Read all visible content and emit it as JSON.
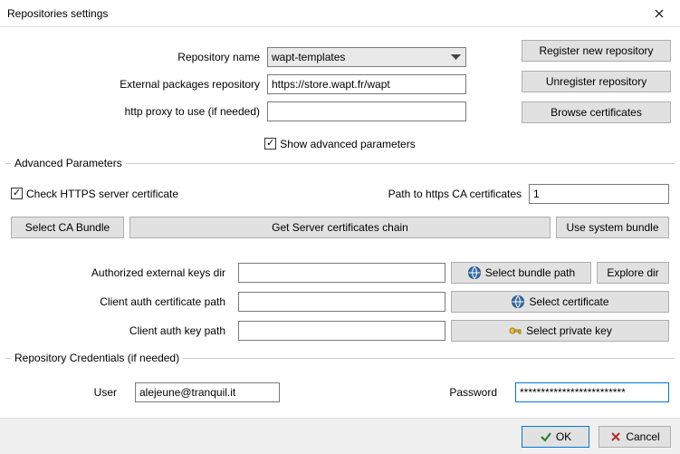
{
  "window": {
    "title": "Repositories settings"
  },
  "labels": {
    "repo_name": "Repository name",
    "ext_repo": "External packages repository",
    "http_proxy": "http proxy to use (if needed)",
    "show_advanced": "Show advanced parameters",
    "adv_params": "Advanced Parameters",
    "check_https": "Check HTTPS server certificate",
    "path_ca": "Path to https CA certificates",
    "auth_keys_dir": "Authorized external keys dir",
    "client_cert_path": "Client auth certificate path",
    "client_key_path": "Client auth key path",
    "repo_creds": "Repository Credentials (if needed)",
    "user": "User",
    "password": "Password"
  },
  "buttons": {
    "register": "Register new repository",
    "unregister": "Unregister repository",
    "browse_certs": "Browse certificates",
    "select_ca_bundle": "Select CA Bundle",
    "get_server_chain": "Get Server certificates chain",
    "use_system_bundle": "Use system bundle",
    "select_bundle_path": "Select bundle path",
    "explore_dir": "Explore dir",
    "select_certificate": "Select certificate",
    "select_private_key": "Select private key",
    "ok": "OK",
    "cancel": "Cancel"
  },
  "values": {
    "repo_name": "wapt-templates",
    "ext_repo": "https://store.wapt.fr/wapt",
    "http_proxy": "",
    "ca_path": "1",
    "auth_keys_dir": "",
    "client_cert_path": "",
    "client_key_path": "",
    "user": "alejeune@tranquil.it",
    "password": "*************************"
  },
  "checks": {
    "show_advanced": true,
    "check_https": true
  }
}
